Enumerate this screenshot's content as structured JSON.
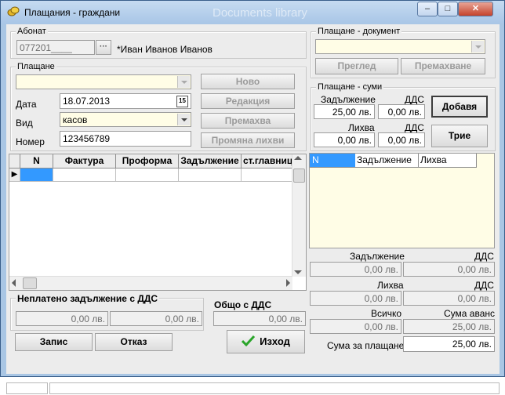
{
  "window": {
    "title": "Плащания - граждани",
    "ghost_title": "Documents library",
    "minimize_glyph": "–",
    "maximize_glyph": "□",
    "close_glyph": "✕"
  },
  "subscriber": {
    "group_label": "Абонат",
    "number": "077201____",
    "browse_glyph": "···",
    "name": "*Иван Иванов Иванов"
  },
  "payment": {
    "group_label": "Плащане",
    "date_label": "Дата",
    "date_value": "18.07.2013",
    "calendar_glyph": "15",
    "type_label": "Вид",
    "type_value": "касов",
    "number_label": "Номер",
    "number_value": "123456789",
    "btn_new": "Ново",
    "btn_edit": "Редакция",
    "btn_remove": "Премахва",
    "btn_change_interest": "Промяна лихви"
  },
  "invoices_grid": {
    "columns": [
      "N",
      "Фактура",
      "Проформа",
      "Задължение",
      "ст.главница"
    ],
    "row_indicator": "▶"
  },
  "unpaid": {
    "label": "Неплатено задължение с ДДС",
    "value1": "0,00 лв.",
    "value2": "0,00 лв.",
    "total_label": "Общо с ДДС",
    "total_value": "0,00 лв."
  },
  "actions": {
    "save": "Запис",
    "cancel": "Отказ",
    "exit": "Изход"
  },
  "payment_doc": {
    "group_label": "Плащане - документ",
    "btn_view": "Преглед",
    "btn_remove": "Премахване"
  },
  "payment_sums": {
    "group_label": "Плащане - суми",
    "obligation_label": "Задължение",
    "obligation_value": "25,00 лв.",
    "vat_label": "ДДС",
    "vat_value": "0,00 лв.",
    "interest_label": "Лихва",
    "interest_value": "0,00 лв.",
    "vat2_label": "ДДС",
    "vat2_value": "0,00 лв.",
    "btn_add": "Добавя",
    "btn_clear": "Трие"
  },
  "sums_grid": {
    "columns": [
      "N",
      "Задължение",
      "Лихва"
    ]
  },
  "totals": {
    "obligation_label": "Задължение",
    "obligation_value": "0,00 лв.",
    "vat_label": "ДДС",
    "vat_value": "0,00 лв.",
    "interest_label": "Лихва",
    "interest_value": "0,00 лв.",
    "vat2_label": "ДДС",
    "vat2_value": "0,00 лв.",
    "all_label": "Всичко",
    "all_value": "0,00 лв.",
    "advance_label": "Сума аванс",
    "advance_value": "25,00 лв.",
    "pay_label": "Сума за плащане",
    "pay_value": "25,00 лв."
  },
  "colors": {
    "selected_cell": "#3399ff",
    "input_yellow": "#fffde6",
    "exit_check": "#2aa52a"
  }
}
